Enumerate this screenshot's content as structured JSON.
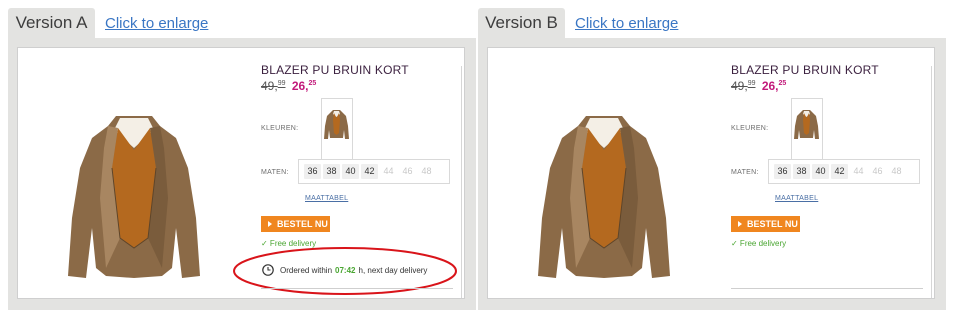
{
  "colors": {
    "panel_bg": "#e3e3e1",
    "link": "#3a76c4",
    "sale_price": "#c2187a",
    "order_button": "#f0861f",
    "green": "#4aa632",
    "highlight_ellipse": "#d9141a"
  },
  "version_a": {
    "tab_label": "Version A",
    "enlarge_link": "Click to enlarge",
    "product": {
      "title": "BLAZER PU BRUIN KORT",
      "old_price_main": "49,",
      "old_price_cents": "99",
      "new_price_main": "26,",
      "new_price_cents": "25",
      "colors_label": "KLEUREN:",
      "sizes_label": "MATEN:",
      "sizes": [
        {
          "label": "36",
          "available": true
        },
        {
          "label": "38",
          "available": true
        },
        {
          "label": "40",
          "available": true
        },
        {
          "label": "42",
          "available": true
        },
        {
          "label": "44",
          "available": false
        },
        {
          "label": "46",
          "available": false
        },
        {
          "label": "48",
          "available": false
        }
      ],
      "size_chart": "MAATTABEL",
      "order_button": "BESTEL NU",
      "delivery": "✓ Free delivery",
      "urgency_prefix": "Ordered within",
      "urgency_time": "07:42",
      "urgency_suffix": "h, next day delivery"
    }
  },
  "version_b": {
    "tab_label": "Version B",
    "enlarge_link": "Click to enlarge",
    "product": {
      "title": "BLAZER PU BRUIN KORT",
      "old_price_main": "49,",
      "old_price_cents": "99",
      "new_price_main": "26,",
      "new_price_cents": "25",
      "colors_label": "KLEUREN:",
      "sizes_label": "MATEN:",
      "sizes": [
        {
          "label": "36",
          "available": true
        },
        {
          "label": "38",
          "available": true
        },
        {
          "label": "40",
          "available": true
        },
        {
          "label": "42",
          "available": true
        },
        {
          "label": "44",
          "available": false
        },
        {
          "label": "46",
          "available": false
        },
        {
          "label": "48",
          "available": false
        }
      ],
      "size_chart": "MAATTABEL",
      "order_button": "BESTEL NU",
      "delivery": "✓ Free delivery"
    }
  },
  "icons": {
    "clock": "clock-icon",
    "arrow": "play-arrow-icon",
    "check": "check-icon"
  }
}
